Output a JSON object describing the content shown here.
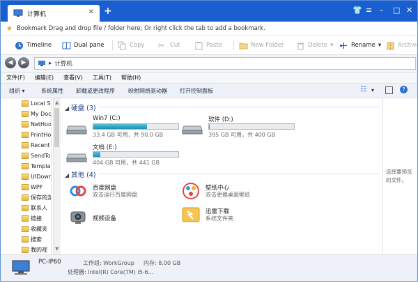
{
  "tab": {
    "title": "计算机",
    "close": "✕",
    "new_tab": "+"
  },
  "window_controls": {
    "shirt": "👕",
    "menu": "≡",
    "minimize": "–",
    "maximize": "□",
    "close": "✕"
  },
  "bookmark_bar": {
    "text": "Bookmark  Drag and drop file / folder here; Or right click the tab to add a bookmark."
  },
  "toolbar": {
    "timeline": "Timeline",
    "dual_pane": "Dual pane",
    "copy": "Copy",
    "cut": "Cut",
    "paste": "Paste",
    "new_folder": "New Folder",
    "delete": "Delete",
    "rename": "Rename",
    "archive": "Archive",
    "dropdown": "▾"
  },
  "address": {
    "back": "◀",
    "forward": "▶",
    "path_prefix": "▸",
    "path": "计算机"
  },
  "menu": [
    "文件(F)",
    "编辑(E)",
    "查看(V)",
    "工具(T)",
    "帮助(H)"
  ],
  "commands": {
    "organize": "组织 ▾",
    "system_properties": "系统属性",
    "uninstall": "卸载或更改程序",
    "map_drive": "映射网络驱动器",
    "control_panel": "打开控制面板"
  },
  "nav_items": [
    "Local S",
    "My Doc",
    "NetHoo",
    "PrintHo",
    "Recent",
    "SendTo",
    "Templa",
    "UIDown",
    "WPF",
    "保存的游",
    "联系人",
    "链接",
    "收藏夹",
    "搜索",
    "我的视"
  ],
  "groups": {
    "disks": "硬盘 (3)",
    "other": "其他 (4)",
    "arrow": "◢"
  },
  "drives": [
    {
      "name": "Win7 (C:)",
      "used_fraction": 0.63,
      "info": "33.4 GB 可用，共 90.0 GB"
    },
    {
      "name": "软件 (D:)",
      "used_fraction": 0.01,
      "info": "395 GB 可用，共 400 GB"
    },
    {
      "name": "文档 (E:)",
      "used_fraction": 0.08,
      "info": "404 GB 可用，共 441 GB"
    }
  ],
  "apps": [
    {
      "name": "百度网盘",
      "desc": "双击运行百度网盘"
    },
    {
      "name": "壁纸中心",
      "desc": "双击更换桌面壁纸"
    },
    {
      "name": "视频设备",
      "desc": ""
    },
    {
      "name": "迅雷下载",
      "desc": "系统文件夹"
    }
  ],
  "preview": {
    "line1": "选择要预览",
    "line2": "的文件。"
  },
  "details": {
    "pc_name": "PC-IP60",
    "workgroup": "工作组: WorkGroup",
    "memory": "内存: 8.00 GB",
    "processor": "处理器: Intel(R) Core(TM) i5-6..."
  },
  "colors": {
    "titlebar": "#1a5fcf",
    "accent": "#1a3c86",
    "bar_fill": "#1b8fb3"
  }
}
